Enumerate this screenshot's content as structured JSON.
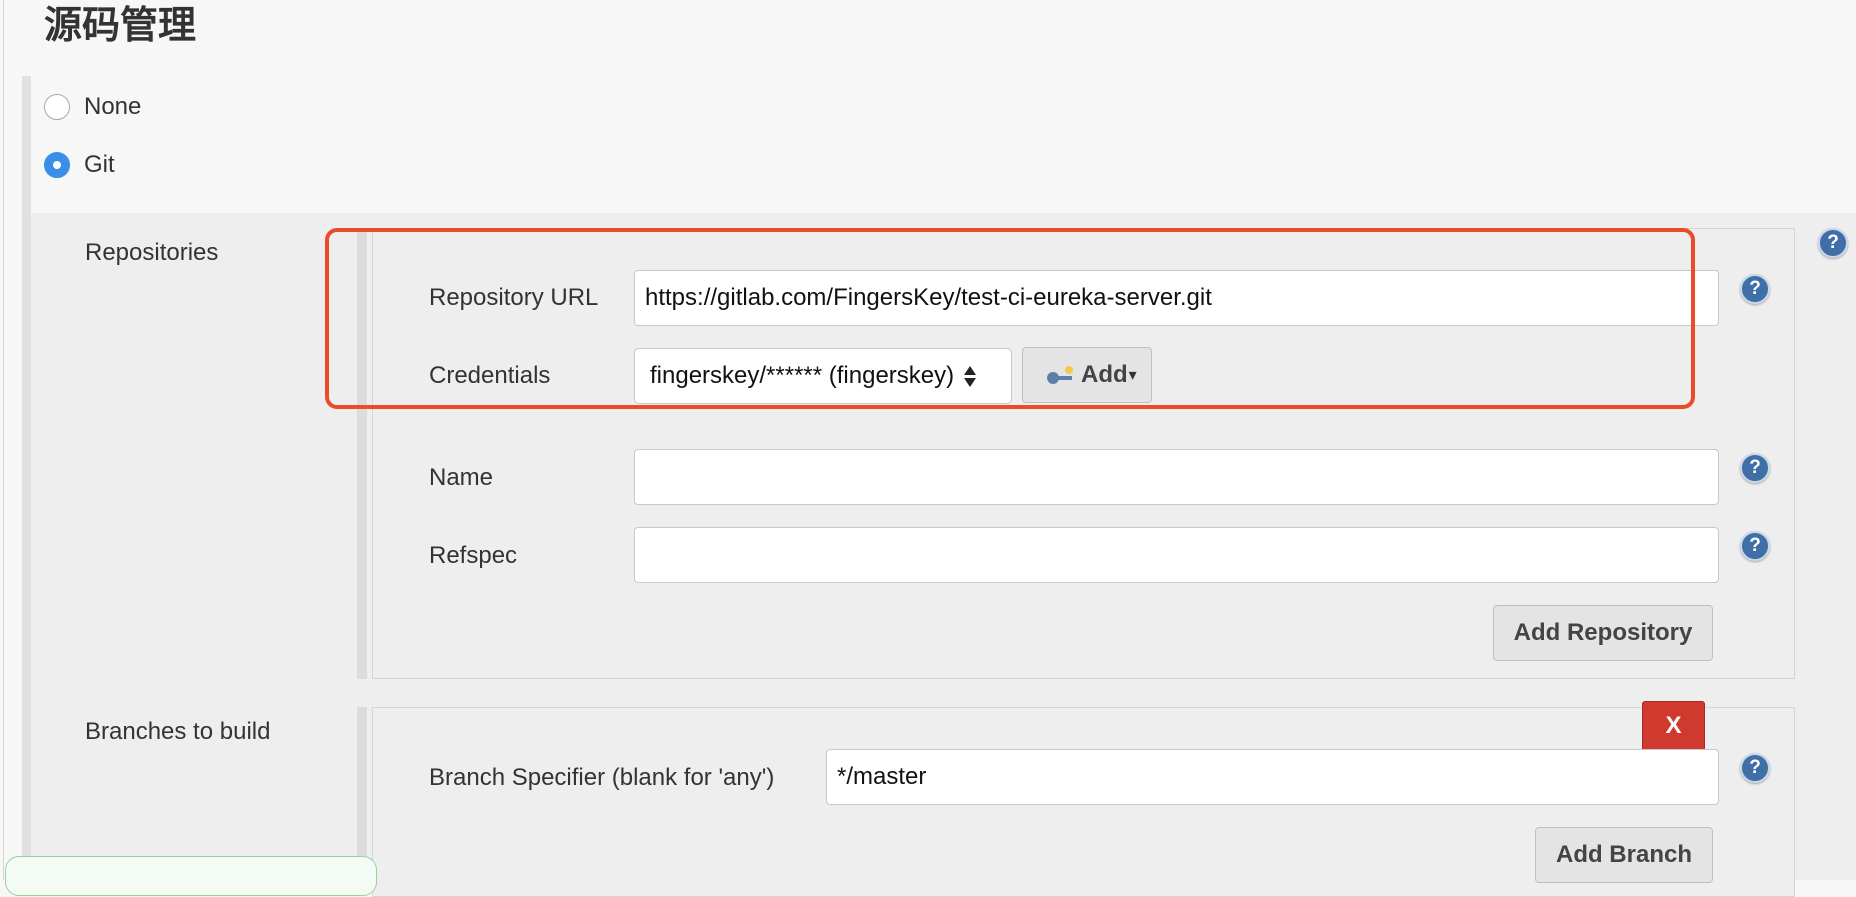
{
  "page": {
    "title": "源码管理"
  },
  "scm": {
    "options": [
      {
        "label": "None",
        "selected": false
      },
      {
        "label": "Git",
        "selected": true
      }
    ]
  },
  "repositories": {
    "section_label": "Repositories",
    "url_label": "Repository URL",
    "url_value": "https://gitlab.com/FingersKey/test-ci-eureka-server.git",
    "credentials_label": "Credentials",
    "credentials_value": "fingerskey/****** (fingerskey)",
    "add_credentials_label": "Add",
    "name_label": "Name",
    "name_value": "",
    "refspec_label": "Refspec",
    "refspec_value": "",
    "add_repository_label": "Add Repository"
  },
  "branches": {
    "section_label": "Branches to build",
    "delete_label": "X",
    "specifier_label": "Branch Specifier (blank for 'any')",
    "specifier_value": "*/master",
    "add_branch_label": "Add Branch"
  },
  "help": {
    "icon_glyph": "?"
  },
  "colors": {
    "highlight_outline": "#ea4b2a",
    "radio_selected": "#3a8ee6",
    "help_icon": "#3f6fa6",
    "delete_button": "#d0392d"
  }
}
